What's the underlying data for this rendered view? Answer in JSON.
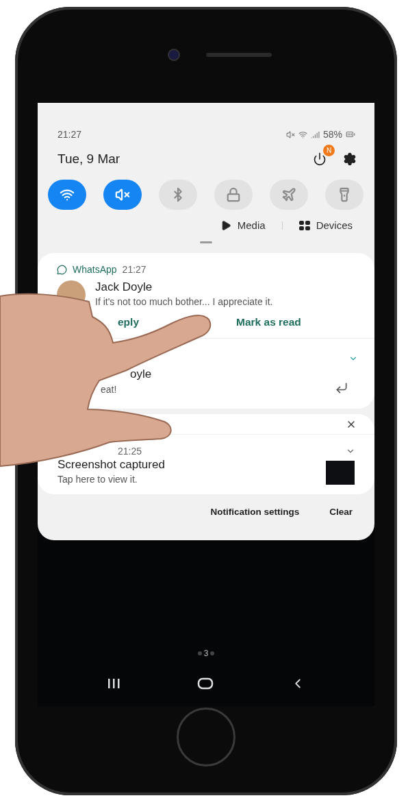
{
  "status_bar": {
    "time": "21:27",
    "battery": "58%"
  },
  "date": "Tue, 9 Mar",
  "power_badge": "N",
  "quick_toggles": [
    {
      "kind": "wifi",
      "on": true
    },
    {
      "kind": "mute",
      "on": true
    },
    {
      "kind": "bluetooth",
      "on": false
    },
    {
      "kind": "lock",
      "on": false
    },
    {
      "kind": "airplane",
      "on": false
    },
    {
      "kind": "flashlight",
      "on": false
    }
  ],
  "media_button": "Media",
  "devices_button": "Devices",
  "whatsapp": {
    "app": "WhatsApp",
    "time": "21:27",
    "sender": "Jack Doyle",
    "message": "If it's not too much bother... I appreciate it.",
    "actions": [
      "eply",
      "Mark as read"
    ]
  },
  "whatsapp_older": {
    "sender": "oyle",
    "message": "eat!"
  },
  "screenshot_notification": {
    "time": "21:25",
    "title": "Screenshot captured",
    "message": "Tap here to view it."
  },
  "footer": {
    "settings": "Notification settings",
    "clear": "Clear"
  },
  "home_page_indicator": "3"
}
